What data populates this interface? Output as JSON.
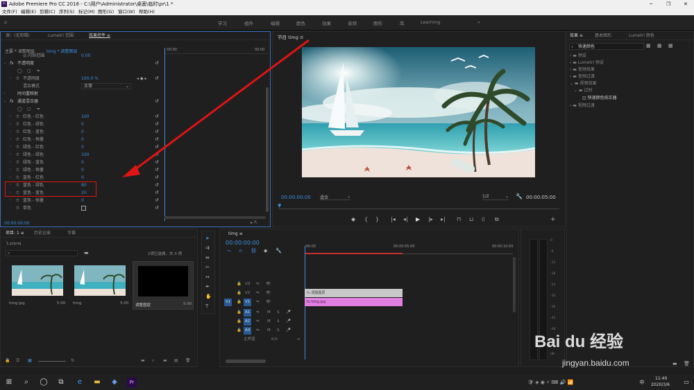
{
  "app": {
    "title": "Adobe Premiere Pro CC 2018 - C:\\用户\\Administrator\\桌面\\临时\\pr\\1 *",
    "icon": "Pr"
  },
  "menu": [
    "文件(F)",
    "编辑(E)",
    "剪辑(C)",
    "序列(S)",
    "标记(M)",
    "图形(G)",
    "窗口(W)",
    "帮助(H)"
  ],
  "workspaces": [
    "学习",
    "组件",
    "编辑",
    "颜色",
    "效果",
    "音频",
    "图形",
    "库",
    "Learning",
    "»"
  ],
  "ec": {
    "tabs": [
      "源：(无剪辑)",
      "Lumetri 范围",
      "效果控件 ≡"
    ],
    "breadcrumb": "主要 * 调整图层",
    "seq": "timg * 调整图层",
    "ruler_start": ":00:00",
    "ruler_end": "00:00",
    "top_partial": {
      "label": "◎ 闪烁范围",
      "value": "0.00"
    },
    "opacity": {
      "header": "不透明度",
      "opacity_label": "不透明度",
      "opacity_value": "100.0 %",
      "blend_label": "混合模式",
      "blend_value": "正常"
    },
    "time_remap": "时间重映射",
    "channel_mixer": "通道混合器",
    "channels": [
      {
        "label": "红色 - 红色",
        "value": "100"
      },
      {
        "label": "红色 - 绿色",
        "value": "0"
      },
      {
        "label": "红色 - 蓝色",
        "value": "0"
      },
      {
        "label": "红色 - 恒量",
        "value": "0"
      },
      {
        "label": "绿色 - 红色",
        "value": "0"
      },
      {
        "label": "绿色 - 绿色",
        "value": "100"
      },
      {
        "label": "绿色 - 蓝色",
        "value": "0"
      },
      {
        "label": "绿色 - 恒量",
        "value": "0"
      },
      {
        "label": "蓝色 - 红色",
        "value": "0"
      },
      {
        "label": "蓝色 - 绿色",
        "value": "80"
      },
      {
        "label": "蓝色 - 蓝色",
        "value": "20"
      },
      {
        "label": "蓝色 - 恒量",
        "value": "0"
      }
    ],
    "mono": "单色",
    "timecode": "00:00:00:00"
  },
  "program": {
    "title": "节目 timg ≡",
    "timecode": "00:00:00:00",
    "fit": "适合",
    "ratio": "1/2",
    "duration": "00:00:05:00"
  },
  "effects": {
    "tabs": [
      "效果 ≡",
      "基本图形",
      "Lumetri 颜色"
    ],
    "search_value": "快速颜色",
    "items": [
      "预设",
      "Lumetri 预设",
      "音频效果",
      "音频过渡",
      "视频效果",
      "过时",
      "快速颜色校正器",
      "视频过渡"
    ]
  },
  "project": {
    "tabs": [
      "项目: 1 ≡",
      "历史记录",
      "字幕"
    ],
    "file": "1.prproj",
    "selection": "1项已选择，共 3 项",
    "clips": [
      {
        "name": "timg.jpg",
        "dur": "5:00"
      },
      {
        "name": "timg",
        "dur": "5:00"
      },
      {
        "name": "调整图层",
        "dur": "5:00"
      }
    ]
  },
  "timeline": {
    "tab": "timg ≡",
    "timecode": "00:00:00:00",
    "ruler": [
      ":00:00",
      "00:00:05:00",
      "00:00:10:00"
    ],
    "video_tracks": [
      "V3",
      "V2",
      "V1"
    ],
    "audio_tracks": [
      "A1",
      "A2",
      "A3"
    ],
    "master": {
      "label": "主声道",
      "value": "0.0"
    },
    "clips": [
      {
        "name": "调整图层",
        "color": "#c8c8c8"
      },
      {
        "name": "timg.jpg",
        "color": "#e07fe0"
      }
    ]
  },
  "meter": {
    "scale": [
      "0",
      "-6",
      "-12",
      "-18",
      "-24",
      "-30",
      "-36",
      "-42",
      "-48",
      "-54",
      "dB"
    ]
  },
  "taskbar": {
    "time": "11:40",
    "date": "2020/3/6",
    "lang": "中"
  },
  "watermark": {
    "brand": "Bai du 经验",
    "url": "jingyan.baidu.com"
  },
  "colors": {
    "accent": "#3d8ee0",
    "annotation": "#e01414",
    "highlight": "#d4d4d4"
  }
}
